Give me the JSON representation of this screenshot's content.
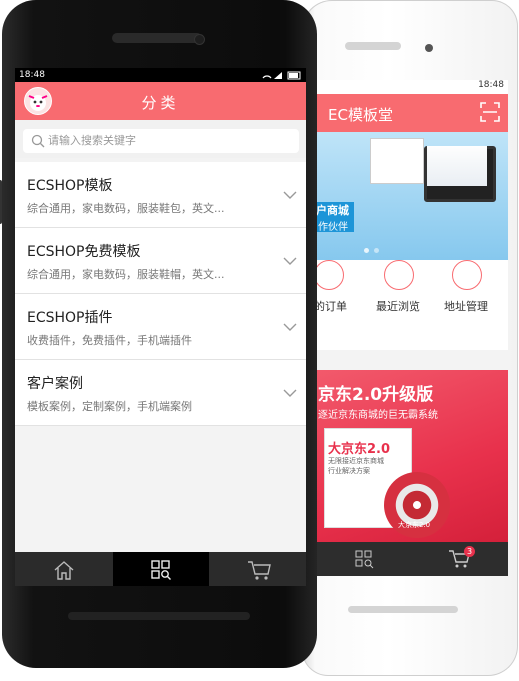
{
  "back_phone": {
    "status_time": "18:48",
    "title": "EC模板堂",
    "scan_icon": "scan-icon",
    "banner": {
      "text1": "户商城",
      "text2": "作伙伴"
    },
    "shortcuts": [
      {
        "label": "的订单",
        "icon": "order-icon"
      },
      {
        "label": "最近浏览",
        "icon": "history-icon"
      },
      {
        "label": "地址管理",
        "icon": "location-icon"
      }
    ],
    "ad": {
      "title": "京东2.0升级版",
      "subtitle": "逐近京东商城的巨无霸系统",
      "box_title": "大京东2.0",
      "box_sub1": "无限接近京东商城",
      "box_sub2": "行业解决方案",
      "disc_label": "大京东2.0"
    },
    "tabs": [
      {
        "icon": "category-icon"
      },
      {
        "icon": "cart-icon"
      }
    ],
    "cart_badge": "3"
  },
  "status": {
    "time": "18:48",
    "icons": "▾ ▴ ▮"
  },
  "header": {
    "title": "分类"
  },
  "search": {
    "placeholder": "请输入搜索关键字"
  },
  "categories": [
    {
      "title": "ECSHOP模板",
      "subtitle": "综合通用，家电数码，服装鞋包，英文..."
    },
    {
      "title": "ECSHOP免费模板",
      "subtitle": "综合通用，家电数码，服装鞋帽，英文..."
    },
    {
      "title": "ECSHOP插件",
      "subtitle": "收费插件，免费插件，手机端插件"
    },
    {
      "title": "客户案例",
      "subtitle": "模板案例，定制案例，手机端案例"
    }
  ],
  "tabbar": [
    {
      "icon": "home-icon",
      "active": false
    },
    {
      "icon": "category-icon",
      "active": true
    },
    {
      "icon": "cart-icon",
      "active": false
    }
  ],
  "colors": {
    "accent": "#f86b70",
    "tabbar": "#2b2b2b"
  }
}
